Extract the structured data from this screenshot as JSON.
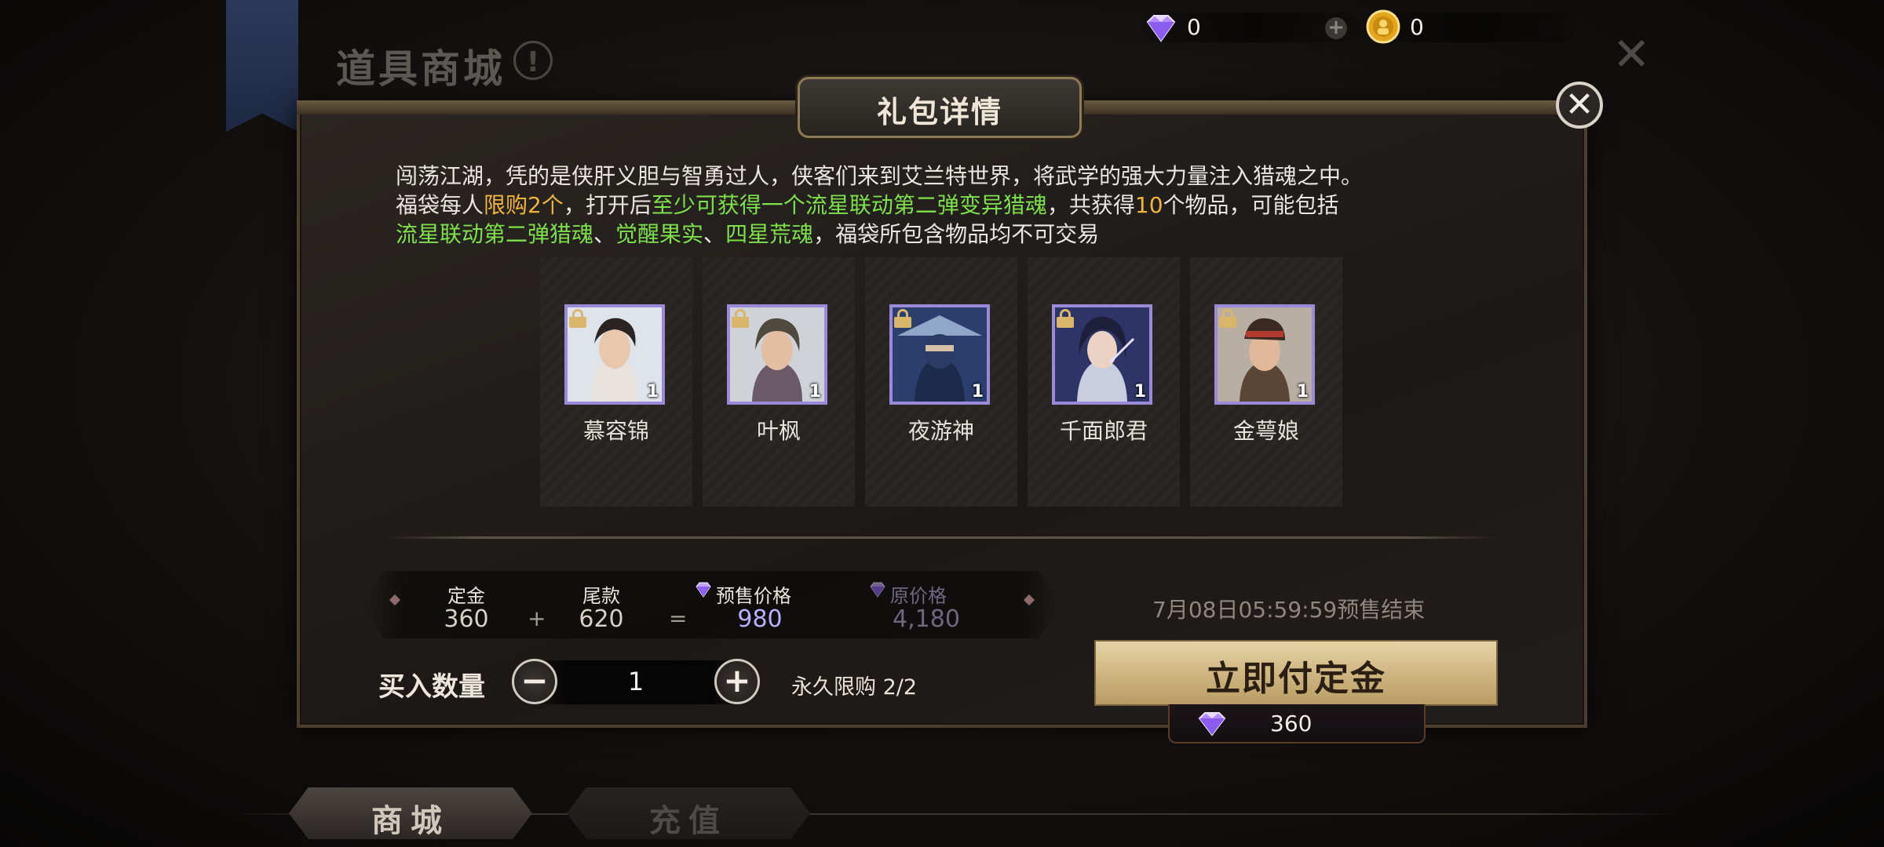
{
  "currency": {
    "diamond_value": "0",
    "coin_value": "0"
  },
  "header": {
    "shop_title": "道具商城",
    "info_symbol": "!",
    "close_symbol": "✕"
  },
  "dialog": {
    "title": "礼包详情",
    "close_symbol": "✕",
    "description": {
      "line1": "闯荡江湖，凭的是侠肝义胆与智勇过人，侠客们来到艾兰特世界，将武学的强大力量注入猎魂之中。",
      "line2_a": "福袋每人",
      "line2_limit": "限购2个",
      "line2_b": "，打开后",
      "line2_guarantee": "至少可获得一个流星联动第二弹变异猎魂",
      "line2_c": "，共获得",
      "line2_count": "10",
      "line2_d": "个物品，可能包括",
      "line3_item1": "流星联动第二弹猎魂",
      "line3_sep1": "、",
      "line3_item2": "觉醒果实",
      "line3_sep2": "、",
      "line3_item3": "四星荒魂",
      "line3_tail": "，福袋所包含物品均不可交易"
    },
    "items": [
      {
        "name": "慕容锦",
        "count": "1"
      },
      {
        "name": "叶枫",
        "count": "1"
      },
      {
        "name": "夜游神",
        "count": "1"
      },
      {
        "name": "千面郎君",
        "count": "1"
      },
      {
        "name": "金萼娘",
        "count": "1"
      }
    ],
    "price": {
      "deposit_label": "定金",
      "deposit_value": "360",
      "plus_symbol": "+",
      "balance_label": "尾款",
      "balance_value": "620",
      "equals_symbol": "=",
      "presale_label": "预售价格",
      "presale_value": "980",
      "original_label": "原价格",
      "original_value": "4,180"
    },
    "presale_end_text": "7月08日05:59:59预售结束",
    "quantity": {
      "label": "买入数量",
      "minus_symbol": "−",
      "value": "1",
      "plus_symbol": "+",
      "limit_text": "永久限购 2/2"
    },
    "pay_button": {
      "label": "立即付定金",
      "cost": "360"
    }
  },
  "tabs": [
    {
      "label": "商城"
    },
    {
      "label": "充值"
    }
  ],
  "colors": {
    "highlight_gold": "#f0b43c",
    "highlight_green": "#7ee04b",
    "presale_price": "#b8b0ff",
    "button_gold": "#cdb47f"
  }
}
